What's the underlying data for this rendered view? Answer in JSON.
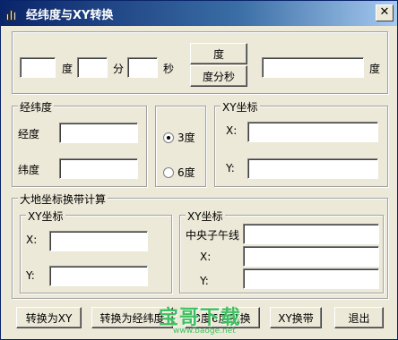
{
  "window": {
    "title": "经纬度与XY转换",
    "close_label": "✕"
  },
  "dms": {
    "deg_unit": "度",
    "min_unit": "分",
    "sec_unit": "秒",
    "deg_value": "",
    "min_value": "",
    "sec_value": "",
    "to_degree_button": "度",
    "to_dms_button": "度分秒",
    "degree_result": "",
    "degree_result_unit": "度"
  },
  "latlon": {
    "label": "经纬度",
    "lon_label": "经度",
    "lat_label": "纬度",
    "lon_value": "",
    "lat_value": ""
  },
  "zone": {
    "option_3": "3度",
    "option_6": "6度",
    "selected": "3度"
  },
  "xy_top": {
    "label": "XY坐标",
    "x_label": "X:",
    "y_label": "Y:",
    "x_value": "",
    "y_value": ""
  },
  "geodetic": {
    "label": "大地坐标换带计算",
    "left": {
      "label": "XY坐标",
      "x_label": "X:",
      "y_label": "Y:",
      "x_value": "",
      "y_value": ""
    },
    "right": {
      "label": "XY坐标",
      "meridian_label": "中央子午线",
      "x_label": "X:",
      "y_label": "Y:",
      "meridian_value": "",
      "x_value": "",
      "y_value": ""
    }
  },
  "buttons": {
    "to_xy": "转换为XY",
    "to_latlon": "转换为经纬度",
    "zone36": "3度6度转换",
    "xy_zone": "XY换带",
    "exit": "退出"
  },
  "watermark": {
    "main": "宝哥下载",
    "sub": "www.baoge.net"
  }
}
